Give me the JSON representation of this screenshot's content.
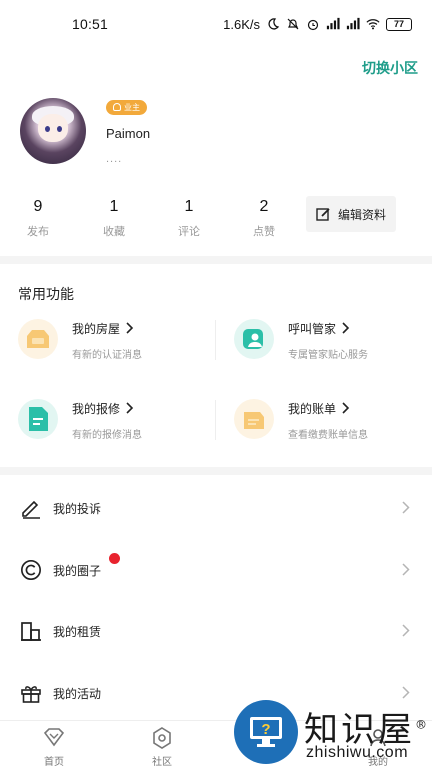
{
  "status_bar": {
    "time": "10:51",
    "network_speed": "1.6K/s",
    "battery": "77"
  },
  "header": {
    "switch_label": "切换小区"
  },
  "profile": {
    "badge": "业主",
    "name": "Paimon",
    "subtitle": "...."
  },
  "stats": [
    {
      "value": "9",
      "label": "发布"
    },
    {
      "value": "1",
      "label": "收藏"
    },
    {
      "value": "1",
      "label": "评论"
    },
    {
      "value": "2",
      "label": "点赞"
    }
  ],
  "edit_profile_label": "编辑资料",
  "common": {
    "title": "常用功能",
    "items": [
      {
        "title": "我的房屋",
        "desc": "有新的认证消息",
        "icon": "house-icon",
        "color": "#f7c874"
      },
      {
        "title": "呼叫管家",
        "desc": "专属管家贴心服务",
        "icon": "butler-icon",
        "color": "#2bbfa8"
      },
      {
        "title": "我的报修",
        "desc": "有新的报修消息",
        "icon": "repair-icon",
        "color": "#2bbfa8"
      },
      {
        "title": "我的账单",
        "desc": "查看缴费账单信息",
        "icon": "bill-icon",
        "color": "#f7c874"
      }
    ]
  },
  "menu": [
    {
      "label": "我的投诉",
      "icon": "pencil-icon"
    },
    {
      "label": "我的圈子",
      "icon": "circle-c-icon",
      "has_dot": true
    },
    {
      "label": "我的租赁",
      "icon": "building-icon"
    },
    {
      "label": "我的活动",
      "icon": "gift-icon"
    }
  ],
  "tab_bar": [
    {
      "label": "首页",
      "icon": "home-diamond-icon"
    },
    {
      "label": "社区",
      "icon": "community-hex-icon"
    },
    {
      "label": "我的",
      "icon": "profile-icon"
    }
  ],
  "watermark": {
    "big": "知识屋",
    "small": "zhishiwu.com",
    "mark": "®"
  },
  "colors": {
    "accent": "#1f9d8a",
    "badge": "#f2a93b",
    "dot": "#e8222e"
  }
}
